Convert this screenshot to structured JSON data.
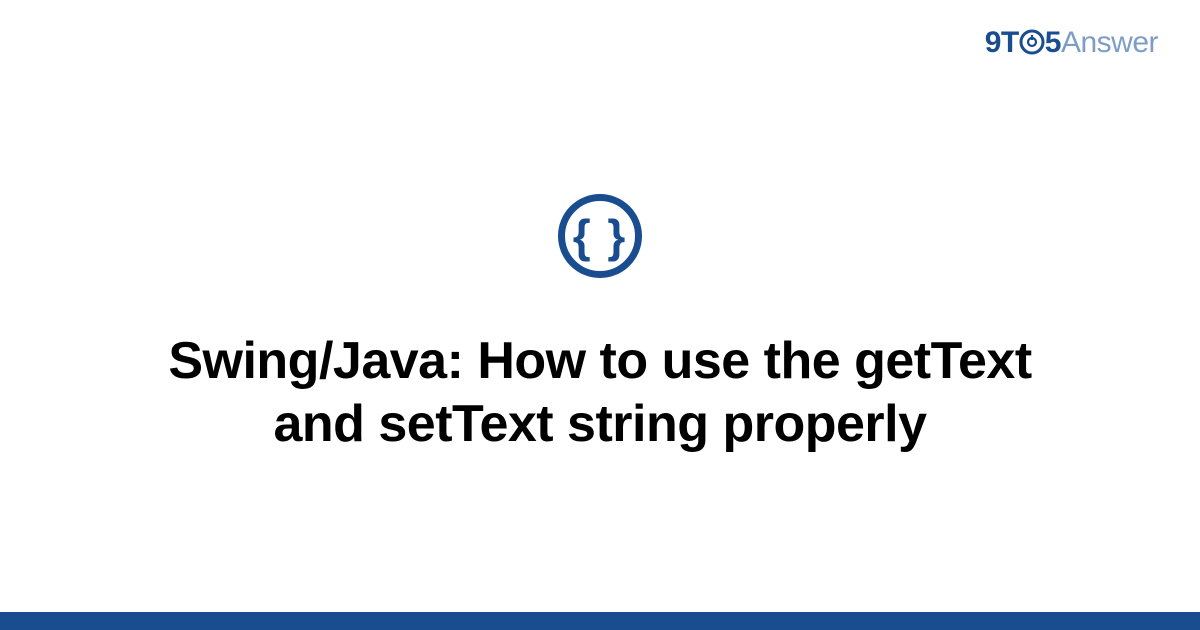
{
  "brand": {
    "part1": "9T",
    "part2": "5",
    "part3": "Answer",
    "logo_o_glyph": "⊙"
  },
  "category": {
    "icon_name": "code-braces-icon",
    "glyph": "{ }"
  },
  "title": "Swing/Java: How to use the getText and setText string properly",
  "colors": {
    "primary": "#1a4d8f",
    "secondary": "#7d9dc7",
    "text": "#000000",
    "background": "#ffffff"
  }
}
